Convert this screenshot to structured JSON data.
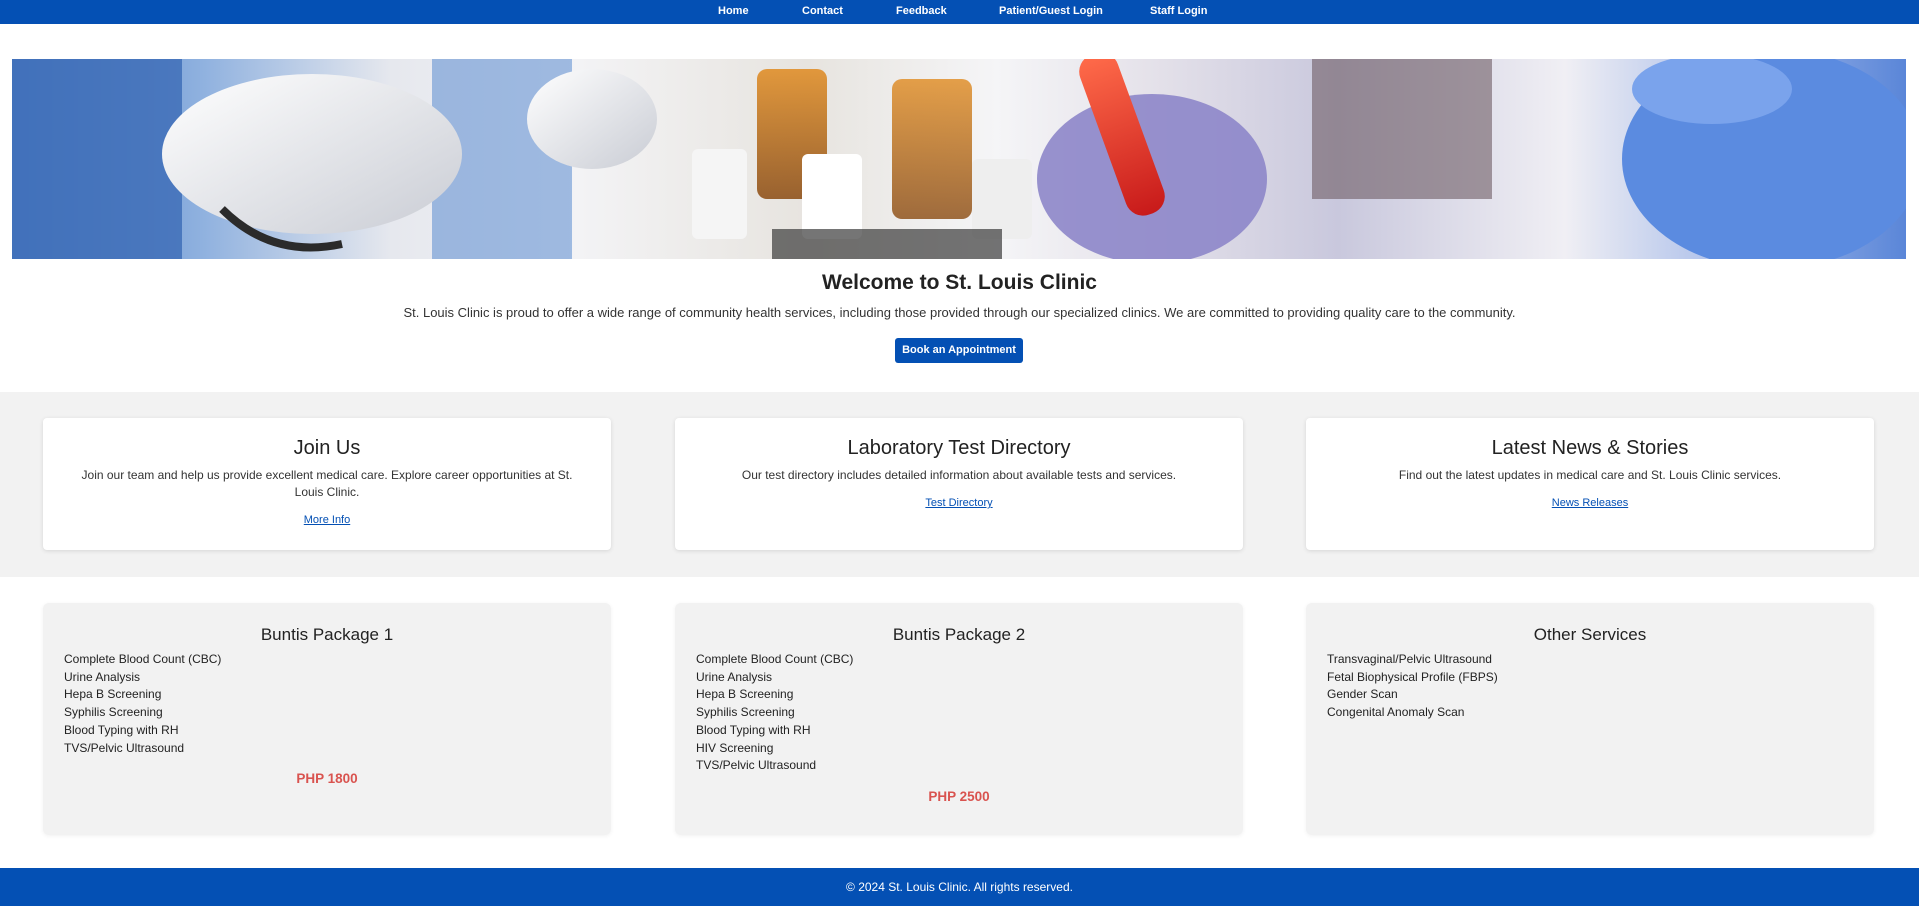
{
  "nav": {
    "items": [
      {
        "label": "Home"
      },
      {
        "label": "Contact"
      },
      {
        "label": "Feedback"
      },
      {
        "label": "Patient/Guest Login"
      },
      {
        "label": "Staff Login"
      }
    ]
  },
  "hero": {
    "image": "laboratory-gloved-hands-blood-sample-image"
  },
  "welcome": {
    "title": "Welcome to St. Louis Clinic",
    "text": "St. Louis Clinic is proud to offer a wide range of community health services, including those provided through our specialized clinics. We are committed to providing quality care to the community.",
    "button_label": "Book an Appointment"
  },
  "info_cards": [
    {
      "title": "Join Us",
      "text": "Join our team and help us provide excellent medical care. Explore career opportunities at St. Louis Clinic.",
      "link": "More Info"
    },
    {
      "title": "Laboratory Test Directory",
      "text": "Our test directory includes detailed information about available tests and services.",
      "link": "Test Directory"
    },
    {
      "title": "Latest News & Stories",
      "text": "Find out the latest updates in medical care and St. Louis Clinic services.",
      "link": "News Releases"
    }
  ],
  "packages": [
    {
      "title": "Buntis Package 1",
      "items": [
        "Complete Blood Count (CBC)",
        "Urine Analysis",
        "Hepa B Screening",
        "Syphilis Screening",
        "Blood Typing with RH",
        "TVS/Pelvic Ultrasound"
      ],
      "price": "PHP 1800"
    },
    {
      "title": "Buntis Package 2",
      "items": [
        "Complete Blood Count (CBC)",
        "Urine Analysis",
        "Hepa B Screening",
        "Syphilis Screening",
        "Blood Typing with RH",
        "HIV Screening",
        "TVS/Pelvic Ultrasound"
      ],
      "price": "PHP 2500"
    },
    {
      "title": "Other Services",
      "items": [
        "Transvaginal/Pelvic Ultrasound",
        "Fetal Biophysical Profile (FBPS)",
        "Gender Scan",
        "Congenital Anomaly Scan"
      ],
      "price": ""
    }
  ],
  "footer": {
    "text": "© 2024 St. Louis Clinic. All rights reserved."
  },
  "colors": {
    "brand_blue": "#0450b4",
    "price_red": "#d9534f",
    "band_gray": "#f2f2f2"
  }
}
